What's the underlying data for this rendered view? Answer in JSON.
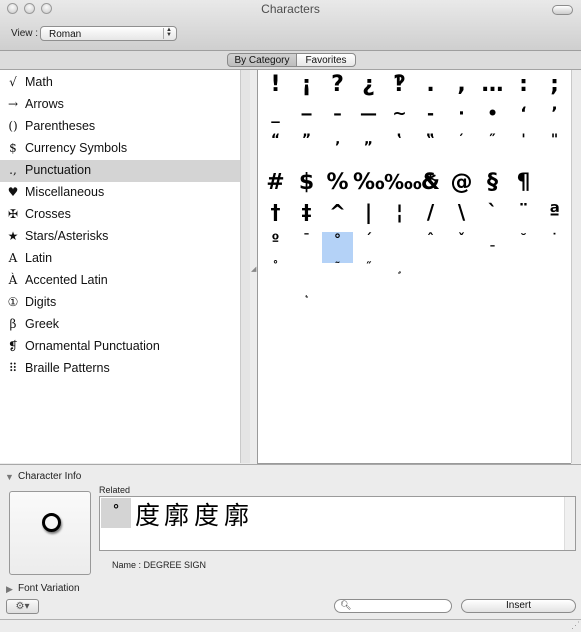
{
  "window": {
    "title": "Characters"
  },
  "toolbar": {
    "view_label": "View :",
    "view_value": "Roman"
  },
  "tabs": [
    {
      "label": "By Category",
      "selected": true
    },
    {
      "label": "Favorites",
      "selected": false
    }
  ],
  "categories": [
    {
      "icon": "√",
      "label": "Math"
    },
    {
      "icon": "→",
      "label": "Arrows"
    },
    {
      "icon": "()",
      "label": "Parentheses"
    },
    {
      "icon": "$",
      "label": "Currency Symbols"
    },
    {
      "icon": ".,",
      "label": "Punctuation",
      "selected": true
    },
    {
      "icon": "♥",
      "label": "Miscellaneous"
    },
    {
      "icon": "✠",
      "label": "Crosses"
    },
    {
      "icon": "★",
      "label": "Stars/Asterisks"
    },
    {
      "icon": "A",
      "label": "Latin"
    },
    {
      "icon": "À",
      "label": "Accented Latin"
    },
    {
      "icon": "①",
      "label": "Digits"
    },
    {
      "icon": "β",
      "label": "Greek"
    },
    {
      "icon": "❡",
      "label": "Ornamental Punctuation"
    },
    {
      "icon": "⠿",
      "label": "Braille Patterns"
    }
  ],
  "grid": {
    "selected_char": "°",
    "rows": [
      [
        "!",
        "¡",
        "?",
        "¿",
        "‽",
        ".",
        ",",
        "…",
        ":",
        ";"
      ],
      [
        "_",
        "‒",
        "–",
        "—",
        "~",
        "‐",
        "·",
        "•",
        "‘",
        "’"
      ],
      [
        "“",
        "”",
        "‚",
        "„",
        "‛",
        "‟",
        "′",
        "″",
        "'",
        "\""
      ],
      [
        "#",
        "$",
        "%",
        "‰",
        "&",
        "*",
        "@",
        "§",
        "¶",
        ""
      ],
      [
        "†",
        "‡",
        "^",
        "|",
        "¦",
        "/",
        "\\",
        "`",
        "¨",
        "ª"
      ],
      [
        "º",
        "¯",
        "°",
        "´",
        "",
        "ˆ",
        "ˇ",
        "ˍ",
        "˘",
        "˙"
      ],
      [
        "˚",
        "",
        "˜",
        "˝",
        "¸",
        "",
        "",
        "",
        "",
        ""
      ],
      [
        "",
        "˛",
        "",
        "",
        "",
        "",
        "",
        "",
        "",
        ""
      ]
    ],
    "extra_ten_thousand": "‱"
  },
  "character_info": {
    "section_label": "Character Info",
    "preview_char": "°",
    "related_label": "Related",
    "related_chars": [
      "°",
      "度",
      "廓",
      "度",
      "廓"
    ],
    "name_label": "Name :",
    "name_value": "DEGREE SIGN"
  },
  "font_variation": {
    "label": "Font Variation"
  },
  "footer": {
    "gear_label": "⚙▾",
    "search_placeholder": "",
    "insert_label": "Insert"
  }
}
